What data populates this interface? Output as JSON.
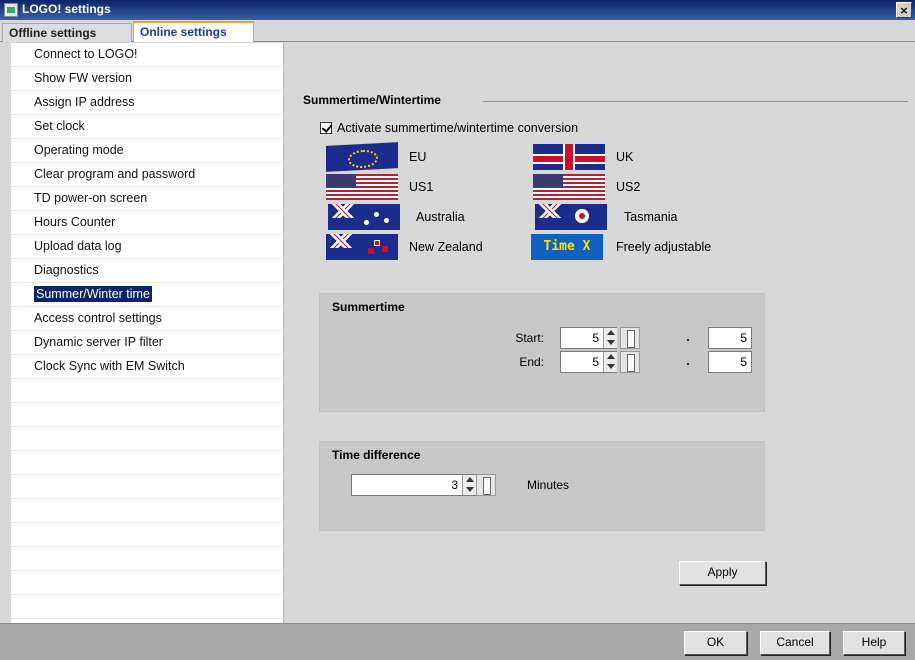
{
  "window": {
    "title": "LOGO! settings",
    "close_glyph": "×"
  },
  "tabs": [
    {
      "label": "Offline settings",
      "active": false
    },
    {
      "label": "Online settings",
      "active": true
    }
  ],
  "sidebar": {
    "items": [
      {
        "label": "Connect to LOGO!"
      },
      {
        "label": "Show FW version"
      },
      {
        "label": "Assign IP address"
      },
      {
        "label": "Set clock"
      },
      {
        "label": "Operating mode"
      },
      {
        "label": "Clear program and password"
      },
      {
        "label": "TD power-on screen"
      },
      {
        "label": "Hours Counter"
      },
      {
        "label": "Upload data log"
      },
      {
        "label": "Diagnostics"
      },
      {
        "label": "Summer/Winter time",
        "selected": true
      },
      {
        "label": "Access control settings"
      },
      {
        "label": "Dynamic server IP filter"
      },
      {
        "label": "Clock Sync with EM Switch"
      }
    ]
  },
  "main": {
    "section_title": "Summertime/Wintertime",
    "activate_checkbox": {
      "label": "Activate summertime/wintertime conversion",
      "checked": true
    },
    "regions": [
      {
        "label": "EU",
        "flag": "eu-flag-icon"
      },
      {
        "label": "UK",
        "flag": "uk-flag-icon"
      },
      {
        "label": "US1",
        "flag": "us-flag-icon"
      },
      {
        "label": "US2",
        "flag": "us-flag-icon"
      },
      {
        "label": "Australia",
        "flag": "australia-flag-icon"
      },
      {
        "label": "Tasmania",
        "flag": "tasmania-flag-icon"
      },
      {
        "label": "New Zealand",
        "flag": "new-zealand-flag-icon"
      },
      {
        "label": "Freely adjustable",
        "flag": "time-x-icon",
        "flag_text": "Time X"
      }
    ],
    "summertime": {
      "title": "Summertime",
      "start_label": "Start:",
      "start_value": "5",
      "start_day": "5",
      "end_label": "End:",
      "end_value": "5",
      "end_day": "5",
      "separator": "·"
    },
    "time_difference": {
      "title": "Time difference",
      "value": "3",
      "unit": "Minutes"
    },
    "apply_label": "Apply"
  },
  "footer": {
    "ok_label": "OK",
    "cancel_label": "Cancel",
    "help_label": "Help"
  }
}
